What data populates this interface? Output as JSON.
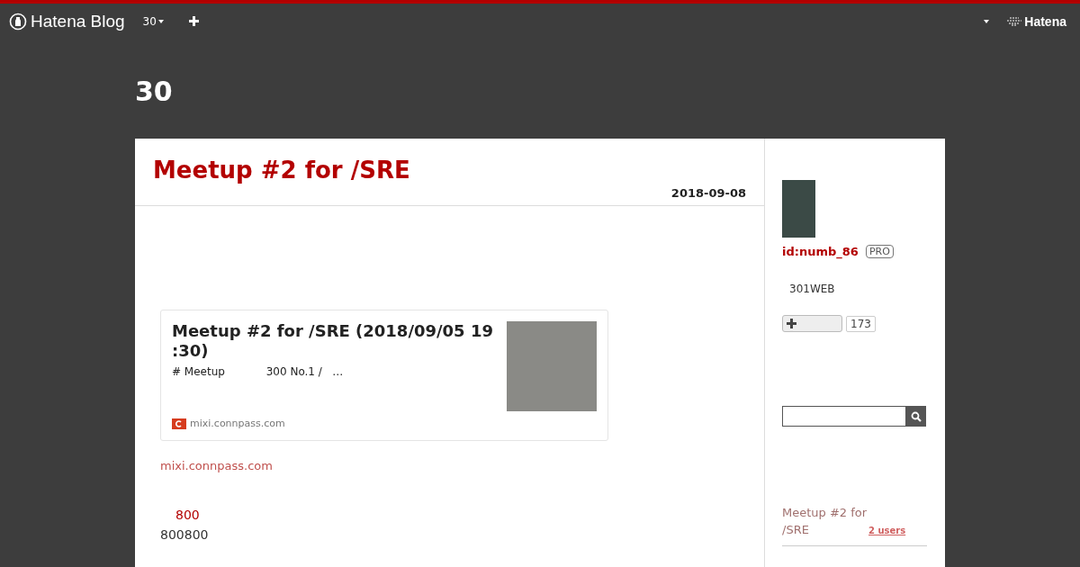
{
  "topbar": {
    "logo": "Hatena Blog",
    "blog_menu": "30",
    "brand": "Hatena"
  },
  "blog_title": "30",
  "entry": {
    "title": "Meetup #2 for /SRE",
    "date": "2018-09-08",
    "embed": {
      "title": "Meetup #2 for /SRE (2018/09/05 19 :30)",
      "description": "# Meetup            300 No.1 /   …",
      "site": "mixi.connpass.com"
    },
    "link": "mixi.connpass.com",
    "highlight": "800",
    "body": "800800"
  },
  "sidebar": {
    "user_id": "id:numb_86",
    "badge": "PRO",
    "bio": "301WEB",
    "subscribe_count": "173",
    "related": [
      {
        "title": "Meetup #2 for /SRE",
        "users": "2 users"
      }
    ]
  }
}
